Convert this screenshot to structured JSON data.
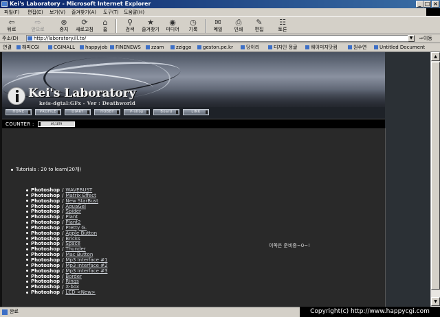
{
  "window": {
    "title": "Kei's Laboratory - Microsoft Internet Explorer",
    "controls": [
      "_",
      "□",
      "×"
    ]
  },
  "menu": [
    "파일(F)",
    "편집(E)",
    "보기(V)",
    "즐겨찾기(A)",
    "도구(T)",
    "도움말(H)"
  ],
  "toolbar": {
    "back": "뒤로",
    "forward": "앞으로",
    "stop": "중지",
    "refresh": "새로고침",
    "home": "홈",
    "search": "검색",
    "favorites": "즐겨찾기",
    "media": "미디어",
    "history": "기록",
    "mail": "메일",
    "print": "인쇄",
    "edit": "편집",
    "discuss": "토론"
  },
  "address": {
    "label": "주소(D)",
    "url": "http://laboratory.ill.to/",
    "go": "이동"
  },
  "links": {
    "label": "연결",
    "items": [
      "해피CGI",
      "CGIMALL",
      "happyjob",
      "FINENEWS",
      "zzam",
      "zziggo",
      "geston.pe.kr",
      "당이리",
      "디자인 정글",
      "웨이미지닷컴",
      "원수연",
      "Untitled Document"
    ]
  },
  "site": {
    "nav": [
      "HOME",
      "PROFILE",
      "DIARY",
      "HOBBY",
      "P-shop",
      "Board",
      "LINK"
    ],
    "counter_label": "COUNTER :",
    "counter_value": "49,1879",
    "logo_title": "Kei's Laboratory",
    "logo_subtitle": "keis-dgtal:GFx - Ver : Deathworld",
    "tutorials": "Tutorials : 20 to learn(20개)",
    "note": "이쪽은 준비중~0~!",
    "separator": "/",
    "list": [
      {
        "category": "Photoshop",
        "title": "WAVEBUST"
      },
      {
        "category": "Photoshop",
        "title": "Matrix Effect"
      },
      {
        "category": "Photoshop",
        "title": "New StarBust"
      },
      {
        "category": "Photoshop",
        "title": "AquaGel"
      },
      {
        "category": "Photoshop",
        "title": "Spider"
      },
      {
        "category": "Photoshop",
        "title": "Plant"
      },
      {
        "category": "Photoshop",
        "title": "Plant2"
      },
      {
        "category": "Photoshop",
        "title": "Pretty G."
      },
      {
        "category": "Photoshop",
        "title": "Apple Button"
      },
      {
        "category": "Photoshop",
        "title": "Bricks"
      },
      {
        "category": "Photoshop",
        "title": "Space"
      },
      {
        "category": "Photoshop",
        "title": "Thunder"
      },
      {
        "category": "Photoshop",
        "title": "Mac Button"
      },
      {
        "category": "Photoshop",
        "title": "Mp3 Interface #1"
      },
      {
        "category": "Photoshop",
        "title": "Mp3 Interface #2"
      },
      {
        "category": "Photoshop",
        "title": "Mp3 Interface #3"
      },
      {
        "category": "Photoshop",
        "title": "Border"
      },
      {
        "category": "Photoshop",
        "title": "Rings"
      },
      {
        "category": "Photoshop",
        "title": "X-box"
      },
      {
        "category": "Photoshop",
        "title": "LCD <New>"
      }
    ]
  },
  "status": {
    "text": "완료",
    "watermark": "Copyright(c) http://www.happycgi.com"
  }
}
